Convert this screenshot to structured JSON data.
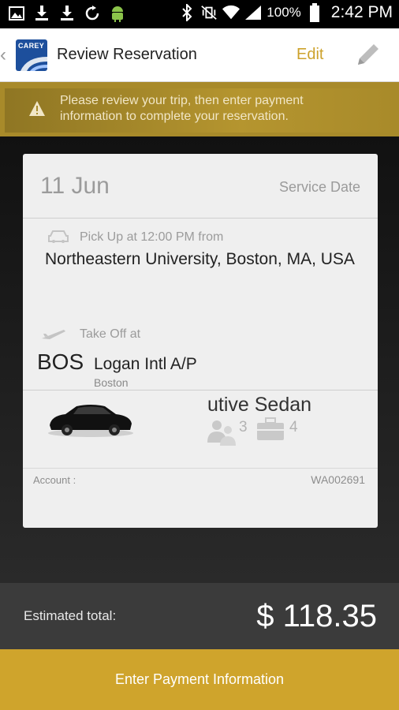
{
  "status_bar": {
    "time": "2:42 PM",
    "battery_percent": "100%",
    "left_icons": [
      "image-icon",
      "download-icon",
      "download-icon",
      "sync-icon",
      "android-icon"
    ],
    "right_icons": [
      "bluetooth-icon",
      "mute-vibrate-icon",
      "wifi-icon",
      "signal-icon",
      "battery-icon"
    ]
  },
  "app_bar": {
    "title": "Review Reservation",
    "edit_label": "Edit",
    "logo_text": "CAREY"
  },
  "banner": {
    "message": "Please review your trip, then enter payment information to complete your reservation."
  },
  "card": {
    "date": "11 Jun",
    "service_date_label": "Service Date",
    "pickup_label": "Pick Up at 12:00 PM from",
    "pickup_address": "Northeastern University, Boston, MA, USA",
    "takeoff_label": "Take Off  at",
    "airport_code": "BOS",
    "airport_name": "Logan Intl A/P",
    "airport_city": "Boston",
    "vehicle_name": "utive Sedan",
    "passengers": "3",
    "bags": "4",
    "account_label": "Account :",
    "account_value": "WA002691"
  },
  "total": {
    "label": "Estimated  total:",
    "value": "$ 118.35"
  },
  "payment_button": {
    "label": "Enter Payment Information"
  },
  "colors": {
    "accent": "#cfa42c",
    "banner": "#a88a2a",
    "total_bar": "#3b3b3b"
  }
}
